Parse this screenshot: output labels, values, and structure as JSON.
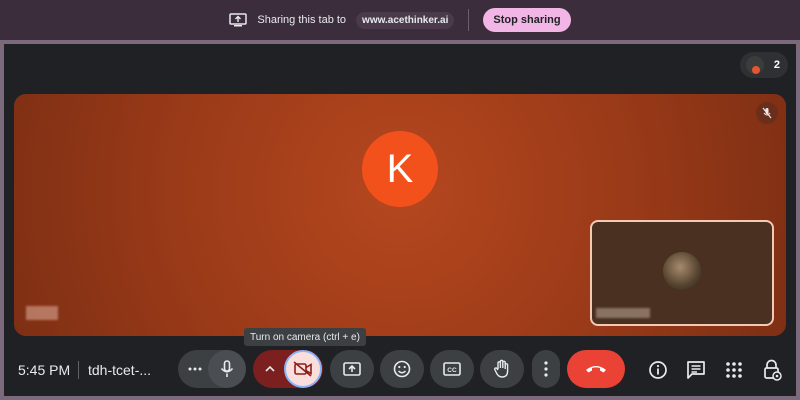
{
  "share_bar": {
    "text": "Sharing this tab to",
    "site": "www.acethinker.ai",
    "stop_label": "Stop sharing"
  },
  "participants": {
    "count": "2"
  },
  "main_tile": {
    "avatar_letter": "K"
  },
  "tooltip": {
    "text": "Turn on camera (ctrl + e)"
  },
  "bottom_bar": {
    "time": "5:45 PM",
    "meeting_code": "tdh-tcet-..."
  },
  "colors": {
    "share_bar": "#3b2d3c",
    "stop_button": "#f2b6e6",
    "tile": "#9a3a18",
    "avatar": "#f2511b",
    "end_call": "#ea4335",
    "camera_off_bg": "#f9dedc",
    "camera_group": "#7b1f1f"
  },
  "icons": {
    "share": "present-to-all-icon",
    "mic": "mic-icon",
    "camera": "videocam-off-icon",
    "present": "present-icon",
    "emoji": "emoji-icon",
    "captions": "captions-icon",
    "hand": "raise-hand-icon",
    "end": "call-end-icon",
    "info": "info-icon",
    "chat": "chat-icon",
    "apps": "apps-icon",
    "host": "host-controls-icon"
  }
}
